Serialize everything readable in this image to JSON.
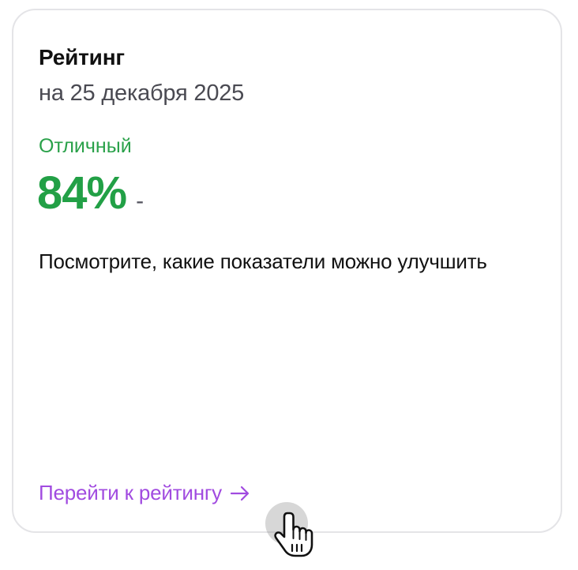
{
  "card": {
    "title": "Рейтинг",
    "date": "на 25 декабря 2025",
    "status_label": "Отличный",
    "score": "84%",
    "score_value_percent": 84,
    "delta": "-",
    "hint": "Посмотрите, какие показатели можно улучшить",
    "link_label": "Перейти к рейтингу",
    "link_icon": "arrow-right-icon"
  },
  "colors": {
    "accent_green": "#22a046",
    "status_green": "#2aa14a",
    "link_purple": "#a14be0",
    "border": "#e4e4e7"
  },
  "cursor": {
    "icon": "hand-pointer-icon"
  }
}
